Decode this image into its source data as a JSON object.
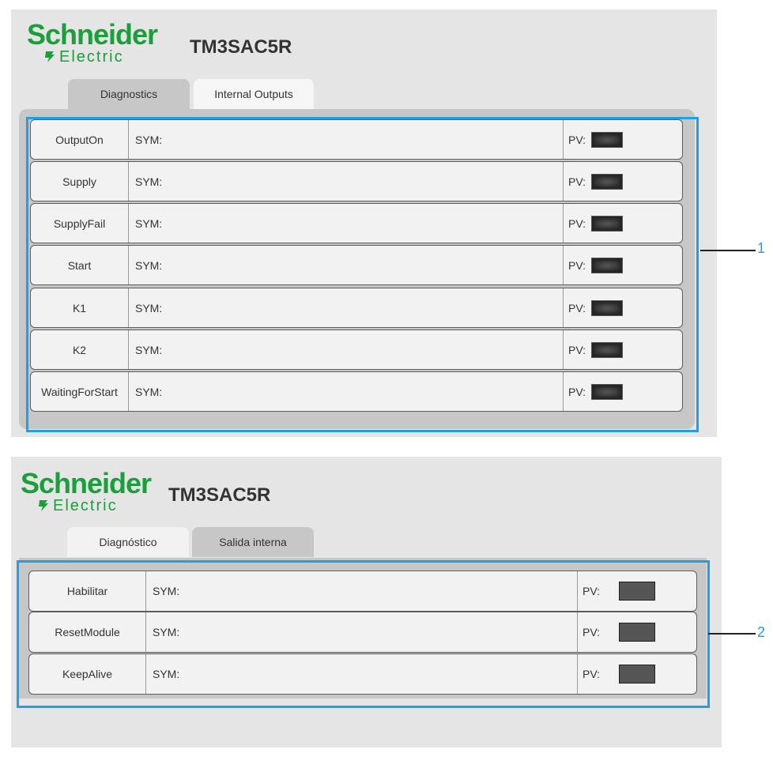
{
  "logo": {
    "brand_top": "Schneider",
    "brand_bottom": "Electric"
  },
  "panel1": {
    "model": "TM3SAC5R",
    "tabs": [
      {
        "label": "Diagnostics",
        "active": true
      },
      {
        "label": "Internal Outputs",
        "active": false
      }
    ],
    "rows": [
      {
        "name": "OutputOn",
        "sym": "SYM:",
        "pv": "PV:"
      },
      {
        "name": "Supply",
        "sym": "SYM:",
        "pv": "PV:"
      },
      {
        "name": "SupplyFail",
        "sym": "SYM:",
        "pv": "PV:"
      },
      {
        "name": "Start",
        "sym": "SYM:",
        "pv": "PV:"
      },
      {
        "name": "K1",
        "sym": "SYM:",
        "pv": "PV:"
      },
      {
        "name": "K2",
        "sym": "SYM:",
        "pv": "PV:"
      },
      {
        "name": "WaitingForStart",
        "sym": "SYM:",
        "pv": "PV:"
      }
    ],
    "callout": "1"
  },
  "panel2": {
    "model": "TM3SAC5R",
    "tabs": [
      {
        "label": "Diagnóstico",
        "active": false
      },
      {
        "label": "Salida interna",
        "active": true
      }
    ],
    "rows": [
      {
        "name": "Habilitar",
        "sym": "SYM:",
        "pv": "PV:"
      },
      {
        "name": "ResetModule",
        "sym": "SYM:",
        "pv": "PV:"
      },
      {
        "name": "KeepAlive",
        "sym": "SYM:",
        "pv": "PV:"
      }
    ],
    "callout": "2"
  },
  "colors": {
    "brand_green": "#1a9f3b",
    "highlight_blue": "#1ea0e6",
    "led_off": "#3a3a3a"
  }
}
